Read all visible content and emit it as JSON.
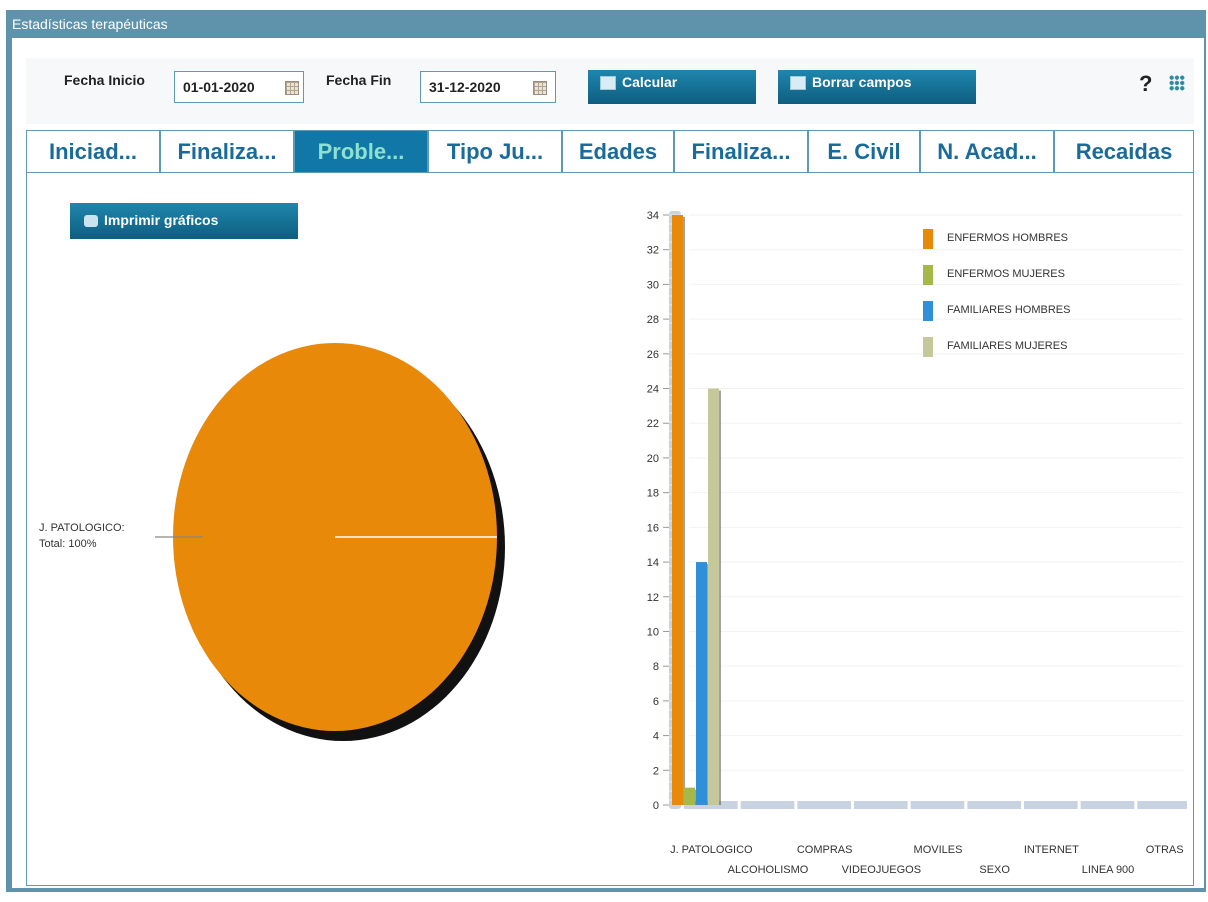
{
  "window": {
    "title": "Estadísticas terapéuticas"
  },
  "toolbar": {
    "start_label": "Fecha Inicio",
    "start_value": "01-01-2020",
    "end_label": "Fecha Fin",
    "end_value": "31-12-2020",
    "calculate_label": "Calcular",
    "clear_label": "Borrar campos",
    "help_label": "?"
  },
  "tabs": [
    {
      "label": "Iniciad...",
      "active": false
    },
    {
      "label": "Finaliza...",
      "active": false
    },
    {
      "label": "Proble...",
      "active": true
    },
    {
      "label": "Tipo Ju...",
      "active": false
    },
    {
      "label": "Edades",
      "active": false
    },
    {
      "label": "Finaliza...",
      "active": false
    },
    {
      "label": "E. Civil",
      "active": false
    },
    {
      "label": "N. Acad...",
      "active": false
    },
    {
      "label": "Recaidas",
      "active": false
    }
  ],
  "print_label": "Imprimir gráficos",
  "colors": {
    "orange": "#e8890a",
    "green": "#a5b84a",
    "blue": "#2f8fd8",
    "khaki": "#c4c89a",
    "tab_active": "#1077a6",
    "window": "#5e93ab"
  },
  "chart_data": [
    {
      "type": "pie",
      "slices": [
        {
          "label": "J. PATOLOGICO:",
          "sublabel": "Total:  100%",
          "value": 100,
          "color": "#e8890a"
        }
      ]
    },
    {
      "type": "bar",
      "categories": [
        "J. PATOLOGICO",
        "ALCOHOLISMO",
        "COMPRAS",
        "VIDEOJUEGOS",
        "MOVILES",
        "SEXO",
        "INTERNET",
        "LINEA 900",
        "OTRAS"
      ],
      "series": [
        {
          "name": "ENFERMOS HOMBRES",
          "color": "#e8890a",
          "values": [
            34,
            0,
            0,
            0,
            0,
            0,
            0,
            0,
            0
          ]
        },
        {
          "name": "ENFERMOS MUJERES",
          "color": "#a5b84a",
          "values": [
            1,
            0,
            0,
            0,
            0,
            0,
            0,
            0,
            0
          ]
        },
        {
          "name": "FAMILIARES HOMBRES",
          "color": "#2f8fd8",
          "values": [
            14,
            0,
            0,
            0,
            0,
            0,
            0,
            0,
            0
          ]
        },
        {
          "name": "FAMILIARES MUJERES",
          "color": "#c4c89a",
          "values": [
            24,
            0,
            0,
            0,
            0,
            0,
            0,
            0,
            0
          ]
        }
      ],
      "ylim": [
        0,
        34
      ],
      "yticks": [
        0,
        2,
        4,
        6,
        8,
        10,
        12,
        14,
        16,
        18,
        20,
        22,
        24,
        26,
        28,
        30,
        32,
        34
      ],
      "legend": "top-right",
      "grid": true
    }
  ]
}
